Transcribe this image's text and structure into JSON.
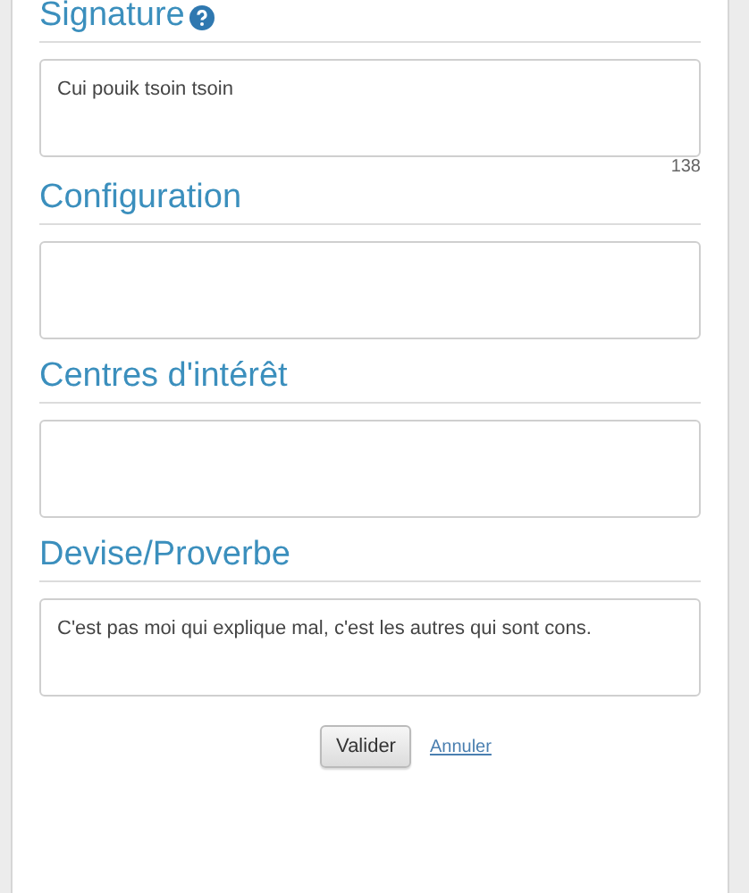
{
  "sections": [
    {
      "title": "Signature",
      "help": true,
      "value": "Cui pouik tsoin tsoin",
      "counter": "138"
    },
    {
      "title": "Configuration"
    },
    {
      "title": "Centres d'intérêt"
    },
    {
      "title": "Devise/Proverbe",
      "value": "C'est pas moi qui explique mal, c'est les autres qui sont cons."
    }
  ],
  "actions": {
    "submit": "Valider",
    "cancel": "Annuler"
  }
}
